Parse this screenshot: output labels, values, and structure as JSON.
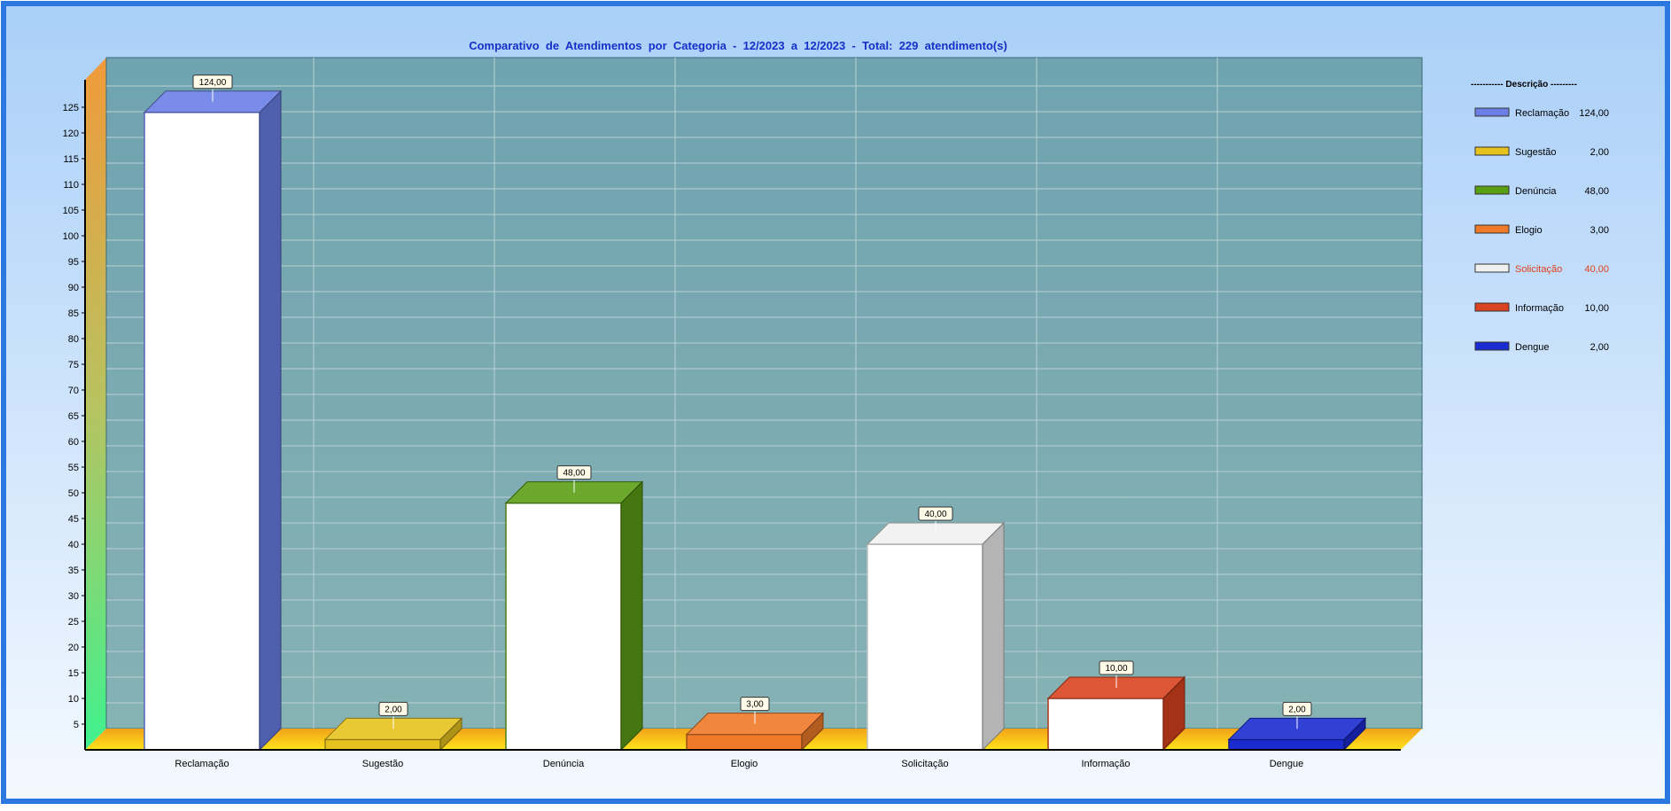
{
  "chart_data": {
    "type": "bar",
    "title": "Comparativo  de  Atendimentos  por  Categoria  -  12/2023  a  12/2023  -  Total:  229  atendimento(s)",
    "xlabel": "",
    "ylabel": "",
    "categories": [
      "Reclamação",
      "Sugestão",
      "Denúncia",
      "Elogio",
      "Solicitação",
      "Informação",
      "Dengue"
    ],
    "values": [
      124,
      2,
      48,
      3,
      40,
      10,
      2
    ],
    "data_labels": [
      "124,00",
      "2,00",
      "48,00",
      "3,00",
      "40,00",
      "10,00",
      "2,00"
    ],
    "colors": [
      "#6b7fe6",
      "#e6c21e",
      "#5a9e14",
      "#ef7a2a",
      "#f0f0f0",
      "#d9431f",
      "#1a2bd0"
    ],
    "face_white": [
      true,
      false,
      true,
      false,
      true,
      true,
      false
    ],
    "ylim": [
      0,
      130
    ],
    "yticks": [
      5,
      10,
      15,
      20,
      25,
      30,
      35,
      40,
      45,
      50,
      55,
      60,
      65,
      70,
      75,
      80,
      85,
      90,
      95,
      100,
      105,
      110,
      115,
      120,
      125
    ],
    "grid": true,
    "legend_position": "right",
    "legend": {
      "title": "----------- Descrição ---------",
      "highlight_index": 4,
      "highlight_color": "#e0401a"
    }
  }
}
